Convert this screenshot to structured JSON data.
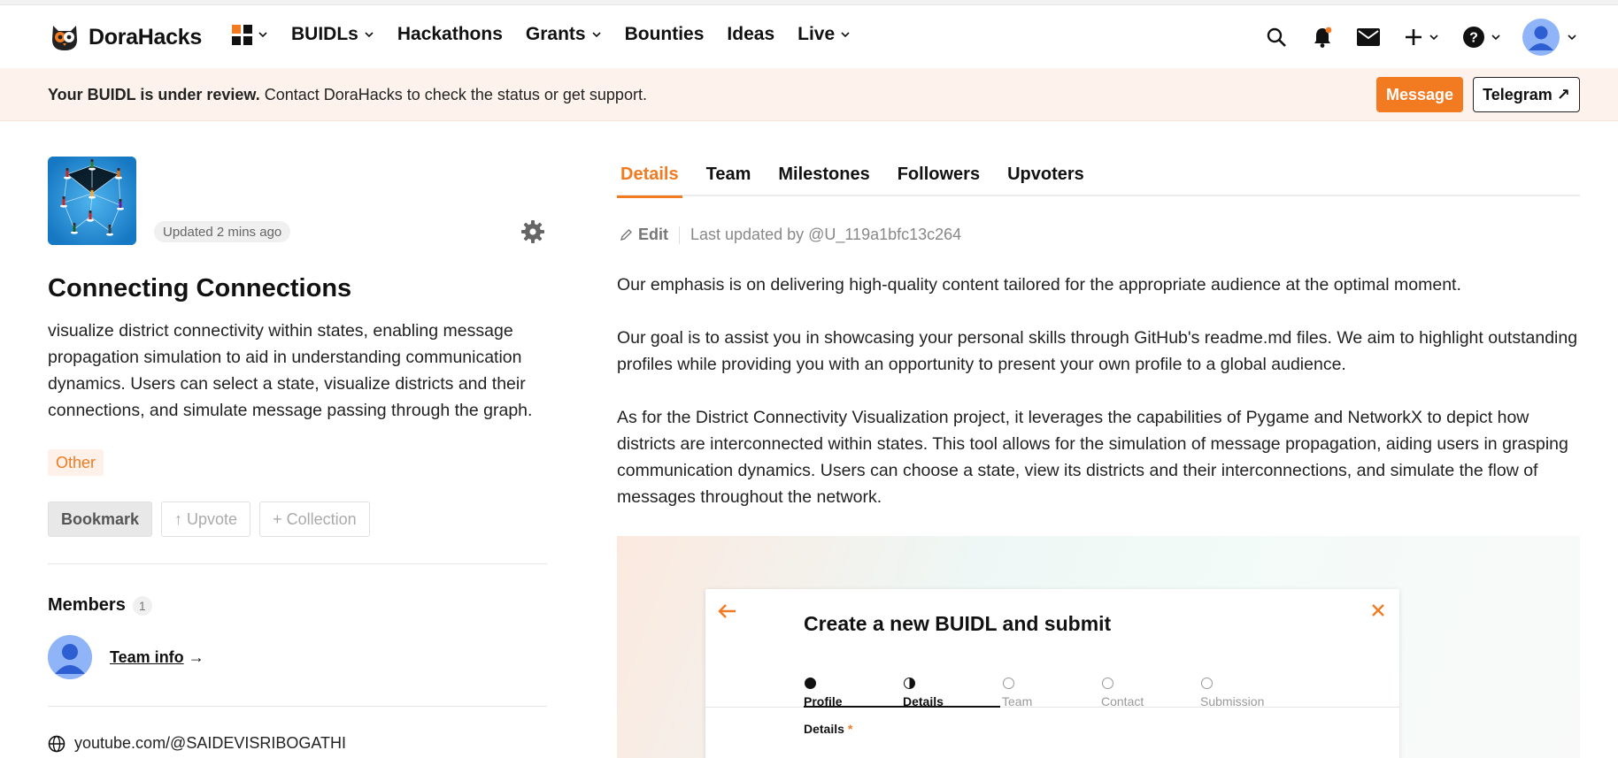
{
  "brand": {
    "name": "DoraHacks"
  },
  "nav": {
    "items": [
      {
        "label": "BUIDLs",
        "has_menu": true
      },
      {
        "label": "Hackathons",
        "has_menu": false
      },
      {
        "label": "Grants",
        "has_menu": true
      },
      {
        "label": "Bounties",
        "has_menu": false
      },
      {
        "label": "Ideas",
        "has_menu": false
      },
      {
        "label": "Live",
        "has_menu": true
      }
    ],
    "icons": [
      "apps-grid-icon",
      "search-icon",
      "bell-icon",
      "mail-icon",
      "plus-icon",
      "help-icon",
      "user-avatar"
    ]
  },
  "banner": {
    "bold": "Your BUIDL is under review.",
    "text": " Contact DoraHacks to check the status or get support.",
    "message_button": "Message",
    "telegram_button": "Telegram ↗"
  },
  "project": {
    "updated": "Updated 2 mins ago",
    "title": "Connecting Connections",
    "description": "visualize district connectivity within states, enabling message propagation simulation to aid in understanding communication dynamics. Users can select a state, visualize districts and their connections, and simulate message passing through the graph.",
    "tag": "Other",
    "actions": {
      "bookmark": "Bookmark",
      "upvote": "↑ Upvote",
      "collection": "+ Collection"
    },
    "members_heading": "Members",
    "members_count": "1",
    "team_link": "Team info",
    "team_arrow": "→",
    "website": "youtube.com/@SAIDEVISRIBOGATHI"
  },
  "tabs": [
    "Details",
    "Team",
    "Milestones",
    "Followers",
    "Upvoters"
  ],
  "details": {
    "edit": "Edit",
    "last_updated": "Last updated by @U_119a1bfc13c264",
    "paragraphs": [
      "Our emphasis is on delivering high-quality content tailored for the appropriate audience at the optimal moment.",
      "Our goal is to assist you in showcasing your personal skills through GitHub's readme.md files. We aim to highlight outstanding profiles while providing you with an opportunity to present your own profile to a global audience.",
      "As for the District Connectivity Visualization project, it leverages the capabilities of Pygame and NetworkX to depict how districts are interconnected within states. This tool allows for the simulation of message propagation, aiding users in grasping communication dynamics. Users can choose a state, view its districts and their interconnections, and simulate the flow of messages throughout the network."
    ]
  },
  "embedded": {
    "title": "Create a new BUIDL and submit",
    "steps": [
      "Profile",
      "Details",
      "Team",
      "Contact",
      "Submission"
    ],
    "field_label": "Details",
    "required_mark": "*"
  },
  "colors": {
    "accent": "#f27b21",
    "banner_bg": "#fdf3ec"
  }
}
